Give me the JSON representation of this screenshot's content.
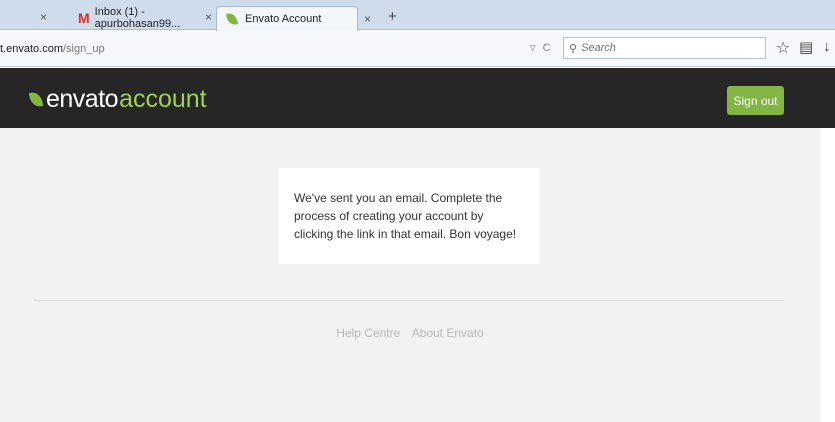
{
  "browser": {
    "tabs": [
      {
        "label": "",
        "close": "×"
      },
      {
        "label": "Inbox (1) - apurbohasan99...",
        "icon": "gmail-icon",
        "close": "×"
      },
      {
        "label": "Envato Account",
        "icon": "envato-leaf-icon",
        "close": "×",
        "active": true
      }
    ],
    "new_tab": "+",
    "address": {
      "host": "t.envato.com",
      "path": "/sign_up"
    },
    "search_placeholder": "Search"
  },
  "site": {
    "logo_word": "envato",
    "logo_suffix": "account",
    "signout_label": "Sign out",
    "brand_color": "#82b541",
    "header_color": "#262626"
  },
  "main": {
    "message": "We've sent you an email. Complete the process of creating your account by clicking the link in that email. Bon voyage!"
  },
  "footer": {
    "links": [
      "Help Centre",
      "About Envato"
    ]
  }
}
